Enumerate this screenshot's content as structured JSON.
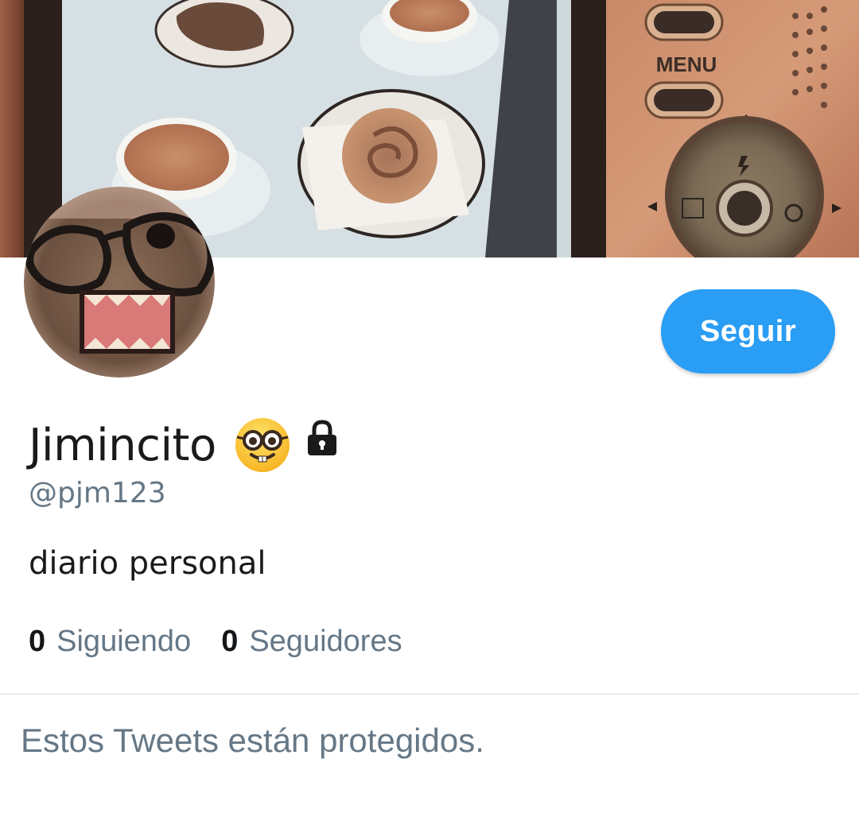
{
  "profile": {
    "display_name": "Jimincito",
    "name_emoji": "nerd-face-emoji",
    "protected_icon": "lock-icon",
    "handle": "@pjm123",
    "bio": "diario personal",
    "follow_button_label": "Seguir",
    "following_count": "0",
    "following_label": "Siguiendo",
    "followers_count": "0",
    "followers_label": "Seguidores"
  },
  "banner": {
    "camera_menu_label": "MENU"
  },
  "timeline": {
    "protected_message": "Estos Tweets están protegidos."
  },
  "colors": {
    "accent": "#2a9df4",
    "secondary_text": "#657786",
    "primary_text": "#1a1a1a",
    "divider": "#e6ecf0"
  }
}
